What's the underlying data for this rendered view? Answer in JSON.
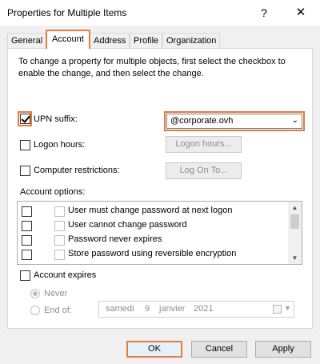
{
  "window": {
    "title": "Properties for Multiple Items",
    "help_glyph": "?",
    "close_glyph": "✕"
  },
  "tabs": [
    {
      "label": "General"
    },
    {
      "label": "Account",
      "active": true
    },
    {
      "label": "Address"
    },
    {
      "label": "Profile"
    },
    {
      "label": "Organization"
    }
  ],
  "intro_text": "To change a property for multiple objects, first select the checkbox to enable the change, and then select the change.",
  "upn": {
    "label": "UPN suffix:",
    "checked": true,
    "value": "@corporate.ovh"
  },
  "logon_hours": {
    "label": "Logon hours:",
    "button": "Logon hours..."
  },
  "computer_restrictions": {
    "label": "Computer restrictions:",
    "button": "Log On To..."
  },
  "account_options": {
    "label": "Account options:",
    "items": [
      "User must change password at next logon",
      "User cannot change password",
      "Password never expires",
      "Store password using reversible encryption"
    ]
  },
  "account_expires": {
    "label": "Account expires",
    "never_label": "Never",
    "end_of_label": "End of:",
    "date": {
      "weekday": "samedi",
      "day": "9",
      "month": "janvier",
      "year": "2021"
    }
  },
  "buttons": {
    "ok": "OK",
    "cancel": "Cancel",
    "apply": "Apply"
  },
  "colors": {
    "highlight": "#e87b3c"
  }
}
